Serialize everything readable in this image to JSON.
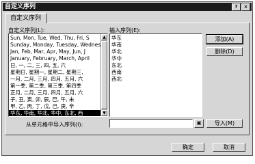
{
  "window": {
    "title": "自定义序列",
    "help_label": "?",
    "close_label": "×"
  },
  "tab": {
    "label": "自定义序列"
  },
  "custom_lists": {
    "label": "自定义序列(L):",
    "items": [
      "Sun, Mon, Tue, Wed, Thu, Fri, S",
      "Sunday, Monday, Tuesday, Wednes",
      "Jan, Feb, Mar, Apr, May, Jun, J",
      "January, February, March, April",
      "日, 一, 二, 三, 四, 五, 六",
      "星期日, 星期一, 星期二, 星期三,",
      "一月, 二月, 三月, 四月, 五月, 六",
      "第一季, 第二季, 第三季, 第四季",
      "正月, 二月, 三月, 四月, 五月, 六",
      "子, 丑, 寅, 卯, 辰, 巳, 午, 未",
      "甲, 乙, 丙, 丁, 戊, 己, 庚, 辛",
      "华东, 华南, 华北, 华中, 东北, 西"
    ],
    "selected_index": 11
  },
  "entries": {
    "label": "输入序列(E):",
    "items": [
      "华东",
      "华南",
      "华北",
      "华中",
      "东北",
      "西南",
      "西北"
    ]
  },
  "buttons": {
    "add": "添加(A)",
    "delete": "删除(D)",
    "import": "导入(M)",
    "ok": "确定",
    "cancel": "取消"
  },
  "import_range": {
    "label": "从单元格中导入序列(I):",
    "value": ""
  },
  "icons": {
    "scroll_up": "▲",
    "scroll_down": "▼",
    "range_picker": "▣"
  }
}
